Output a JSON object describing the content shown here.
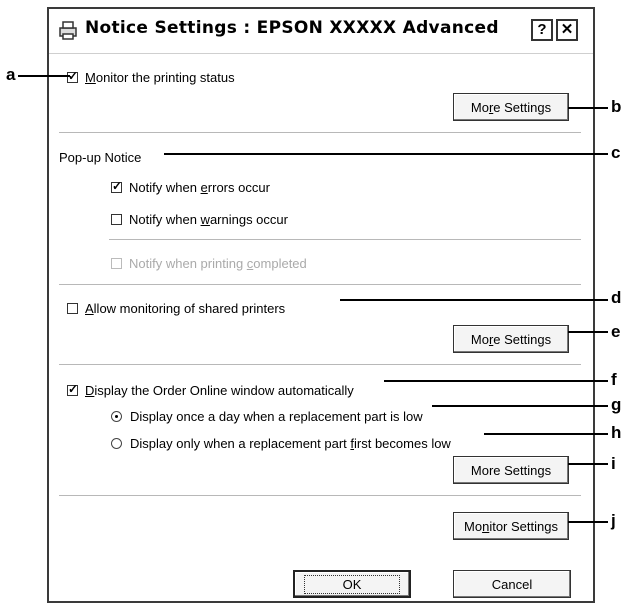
{
  "window": {
    "title": "Notice Settings : EPSON XXXXX Advanced",
    "help_label": "?",
    "close_label": "✕"
  },
  "monitor_status": {
    "label_pre": "",
    "label_u": "M",
    "label_post": "onitor the printing status",
    "checked": true
  },
  "more_settings_1": {
    "pre": "Mo",
    "u": "r",
    "post": "e Settings",
    "plain": "More Settings"
  },
  "popup": {
    "heading": "Pop-up Notice",
    "errors": {
      "pre": "Notify when ",
      "u": "e",
      "post": "rrors occur",
      "checked": true
    },
    "warnings": {
      "pre": "Notify when ",
      "u": "w",
      "post": "arnings occur",
      "checked": false
    },
    "completed": {
      "pre": "Notify when printing ",
      "u": "c",
      "post": "ompleted",
      "checked": false,
      "disabled": true
    }
  },
  "shared": {
    "pre": "",
    "u": "A",
    "post": "llow monitoring of shared printers",
    "checked": false
  },
  "more_settings_2": {
    "pre": "Mo",
    "u": "r",
    "post": "e Settings"
  },
  "order_online": {
    "pre": "",
    "u": "D",
    "post": "isplay the Order Online window automatically",
    "checked": true,
    "radio_once": "Display once a day when a replacement part is low",
    "radio_first_pre": "Display only when a replacement part ",
    "radio_first_u": "f",
    "radio_first_post": "irst becomes low",
    "selected": "once"
  },
  "more_settings_3": {
    "pre": "More Settings"
  },
  "monitor_settings": {
    "pre": "Mo",
    "u": "n",
    "post": "itor Settings"
  },
  "footer": {
    "ok": "OK",
    "cancel": "Cancel"
  },
  "callouts": [
    "a",
    "b",
    "c",
    "d",
    "e",
    "f",
    "g",
    "h",
    "i",
    "j"
  ]
}
